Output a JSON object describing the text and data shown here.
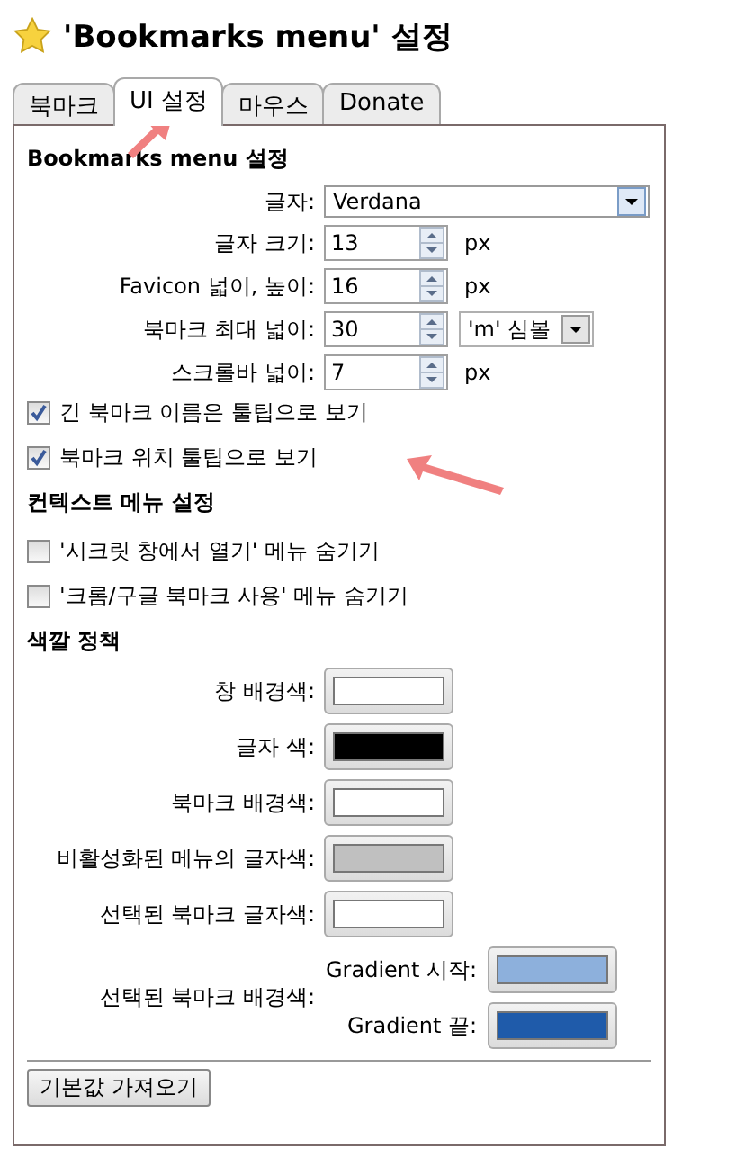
{
  "window": {
    "title": "'Bookmarks menu' 설정"
  },
  "tabs": [
    {
      "label": "북마크",
      "selected": false
    },
    {
      "label": "UI 설정",
      "selected": true
    },
    {
      "label": "마우스",
      "selected": false
    },
    {
      "label": "Donate",
      "selected": false
    }
  ],
  "ui_settings": {
    "heading": "Bookmarks menu 설정",
    "fields": [
      {
        "kind": "select",
        "label": "글자:",
        "value": "Verdana"
      },
      {
        "kind": "spin",
        "label": "글자 크기:",
        "value": "13",
        "unit": "px"
      },
      {
        "kind": "spin",
        "label": "Favicon 넓이, 높이:",
        "value": "16",
        "unit": "px"
      },
      {
        "kind": "spin",
        "label": "북마크 최대 넓이:",
        "value": "30",
        "unit_select": "'m' 심볼"
      },
      {
        "kind": "spin",
        "label": "스크롤바 넓이:",
        "value": "7",
        "unit": "px"
      }
    ],
    "options": [
      {
        "label": "긴 북마크 이름은 툴팁으로 보기",
        "checked": true
      },
      {
        "label": "북마크 위치 툴팁으로 보기",
        "checked": true
      }
    ]
  },
  "context_menu": {
    "heading": "컨텍스트 메뉴 설정",
    "options": [
      {
        "label": "'시크릿 창에서 열기' 메뉴 숨기기",
        "checked": false
      },
      {
        "label": "'크롬/구글 북마크 사용' 메뉴 숨기기",
        "checked": false
      }
    ]
  },
  "colors": {
    "heading": "색깔 정책",
    "items": [
      {
        "label": "창 배경색:",
        "color": "#ffffff"
      },
      {
        "label": "글자 색:",
        "color": "#000000"
      },
      {
        "label": "북마크 배경색:",
        "color": "#ffffff"
      },
      {
        "label": "비활성화된 메뉴의 글자색:",
        "color": "#c0c0c0"
      },
      {
        "label": "선택된 북마크 글자색:",
        "color": "#ffffff"
      }
    ],
    "gradient": {
      "label": "선택된 북마크 배경색:",
      "stops": [
        {
          "label": "Gradient 시작:",
          "color": "#8db0dc"
        },
        {
          "label": "Gradient 끝:",
          "color": "#1f5baa"
        }
      ]
    }
  },
  "reset_button": "기본값 가져오기"
}
